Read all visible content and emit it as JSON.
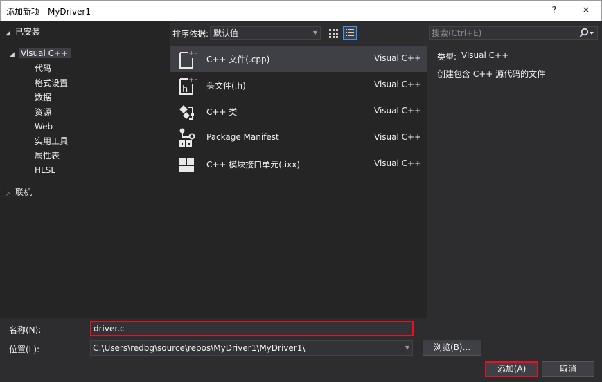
{
  "window": {
    "title": "添加新项 - MyDriver1",
    "help": "?",
    "close": "✕"
  },
  "tree": {
    "installed": "已安装",
    "visual_cpp": "Visual C++",
    "children": [
      "代码",
      "格式设置",
      "数据",
      "资源",
      "Web",
      "实用工具",
      "属性表",
      "HLSL"
    ],
    "online": "联机"
  },
  "toolbar": {
    "sort_label": "排序依据:",
    "sort_value": "默认值"
  },
  "search": {
    "placeholder": "搜索(Ctrl+E)"
  },
  "items": [
    {
      "name": "C++ 文件(.cpp)",
      "lang": "Visual C++",
      "icon": "cpp-file-icon"
    },
    {
      "name": "头文件(.h)",
      "lang": "Visual C++",
      "icon": "header-file-icon"
    },
    {
      "name": "C++ 类",
      "lang": "Visual C++",
      "icon": "class-icon"
    },
    {
      "name": "Package Manifest",
      "lang": "Visual C++",
      "icon": "package-manifest-icon"
    },
    {
      "name": "C++ 模块接口单元(.ixx)",
      "lang": "Visual C++",
      "icon": "module-icon"
    }
  ],
  "info": {
    "type_label": "类型:",
    "type_value": "Visual C++",
    "description": "创建包含 C++ 源代码的文件"
  },
  "bottom": {
    "name_label": "名称(N):",
    "name_value": "driver.c",
    "location_label": "位置(L):",
    "location_value": "C:\\Users\\redbg\\source\\repos\\MyDriver1\\MyDriver1\\",
    "browse": "浏览(B)...",
    "add": "添加(A)",
    "cancel": "取消"
  },
  "colors": {
    "accent": "#68217a",
    "highlight": "#e81123",
    "selection": "#3f3f46"
  }
}
